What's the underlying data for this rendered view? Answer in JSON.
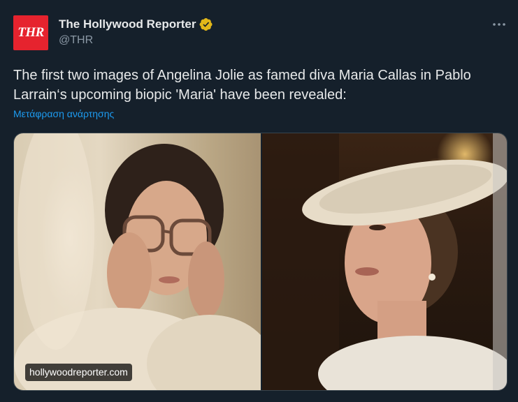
{
  "author": {
    "avatar_text": "THR",
    "display_name": "The Hollywood Reporter",
    "handle": "@THR",
    "verified_badge": "gold-verified-badge-icon",
    "avatar_color": "#e6232e"
  },
  "menu": {
    "icon": "more-options-icon"
  },
  "post": {
    "text_line1": "The first two images of Angelina Jolie as famed diva Maria Callas in Pablo",
    "text_line2": "Larrain‘s upcoming biopic 'Maria' have been revealed:",
    "translate_link": "Μετάφραση ανάρτησης"
  },
  "media": {
    "watermark": "hollywoodreporter.com"
  },
  "colors": {
    "background": "#15202b",
    "text": "#e7e9ea",
    "secondary": "#8b98a5",
    "link": "#1d9bf0",
    "badge": "#e2b719"
  }
}
